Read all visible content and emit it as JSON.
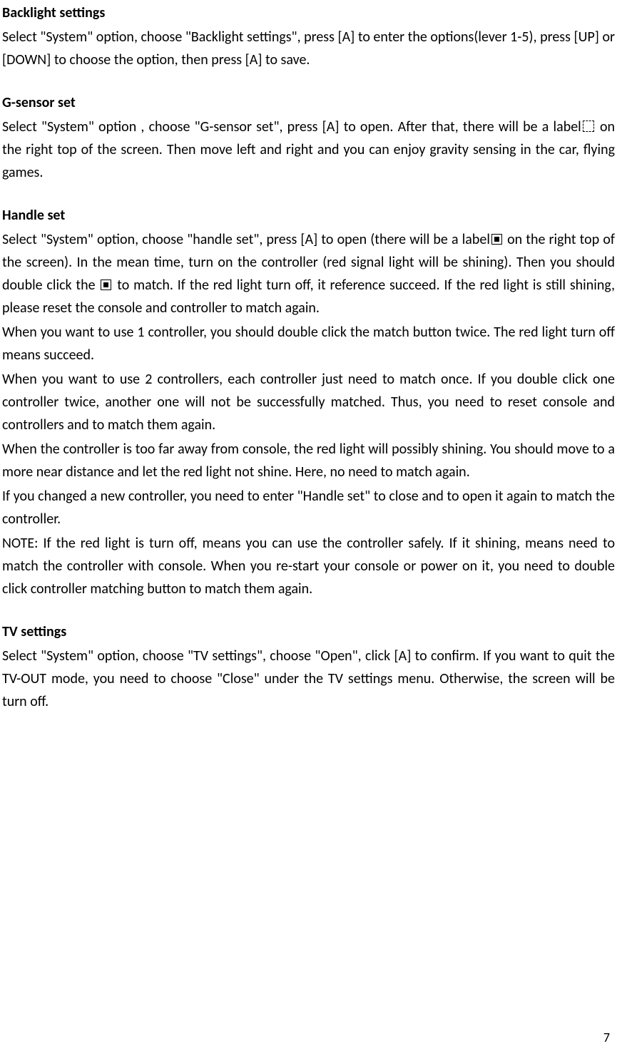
{
  "sections": {
    "backlight": {
      "heading": "Backlight settings",
      "p1": "Select \"System\" option, choose \"Backlight settings\", press [A] to enter the options(lever 1-5), press [UP] or [DOWN] to choose the option, then press [A] to save."
    },
    "gsensor": {
      "heading": "G-sensor set",
      "p1a": "Select \"System\" option , choose \"G-sensor set\", press [A] to open. After that, there will be a label",
      "p1b": " on the right top of the screen. Then move left and right and you can enjoy gravity sensing in the car, flying games."
    },
    "handle": {
      "heading": "Handle set",
      "p1a": "Select \"System\" option, choose \"handle set\", press [A] to open (there will be a label",
      "p1b": " on the right top of the screen). In the mean time, turn on the controller (red signal light will be shining). Then you should double click the ",
      "p1c": " to match. If the red light turn off, it reference succeed. If the red light is still shining, please reset the console and controller to match again.",
      "p2": "When you want to use 1 controller, you should double click the match button twice. The red light turn off means succeed.",
      "p3": "When you want to use 2 controllers, each controller just need to match once. If you double click one controller twice, another one will not be successfully matched. Thus, you need to reset console and controllers and to match them again.",
      "p4": "When the controller is too far away from console, the red light will possibly shining. You should move to a more near distance and let the red light not shine. Here, no need to match again.",
      "p5": "If you changed a new controller, you need to enter \"Handle set\" to close and to open it again to match the controller.",
      "p6": "NOTE: If the red light is turn off, means you can use the controller safely. If it shining, means need to match the controller with console. When you re-start your console or power on it, you need to double click controller matching button to match them again."
    },
    "tv": {
      "heading": "TV settings",
      "p1": "Select \"System\" option, choose \"TV settings\", choose \"Open\", click [A] to confirm. If you want to quit the TV-OUT mode, you need to choose \"Close\" under the TV settings menu. Otherwise, the screen will be turn off."
    }
  },
  "page_number": "7"
}
